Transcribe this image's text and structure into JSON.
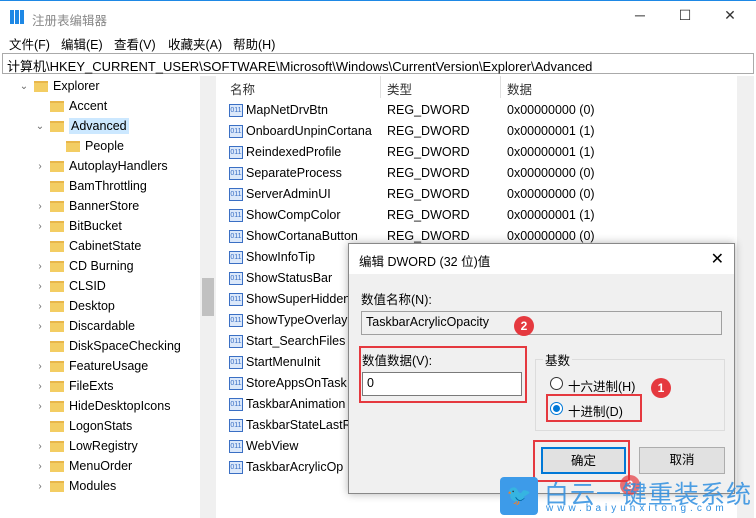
{
  "window": {
    "title": "注册表编辑器",
    "minimize": "─",
    "maximize": "☐",
    "close": "✕"
  },
  "menu": [
    "文件(F)",
    "编辑(E)",
    "查看(V)",
    "收藏夹(A)",
    "帮助(H)"
  ],
  "address": "计算机\\HKEY_CURRENT_USER\\SOFTWARE\\Microsoft\\Windows\\CurrentVersion\\Explorer\\Advanced",
  "tree": [
    {
      "label": "Explorer",
      "level": 0,
      "expanded": true
    },
    {
      "label": "Accent",
      "level": 1
    },
    {
      "label": "Advanced",
      "level": 1,
      "expanded": true,
      "selected": true
    },
    {
      "label": "People",
      "level": 2
    },
    {
      "label": "AutoplayHandlers",
      "level": 1,
      "collapsed": true
    },
    {
      "label": "BamThrottling",
      "level": 1
    },
    {
      "label": "BannerStore",
      "level": 1,
      "collapsed": true
    },
    {
      "label": "BitBucket",
      "level": 1,
      "collapsed": true
    },
    {
      "label": "CabinetState",
      "level": 1
    },
    {
      "label": "CD Burning",
      "level": 1,
      "collapsed": true
    },
    {
      "label": "CLSID",
      "level": 1,
      "collapsed": true
    },
    {
      "label": "Desktop",
      "level": 1,
      "collapsed": true
    },
    {
      "label": "Discardable",
      "level": 1,
      "collapsed": true
    },
    {
      "label": "DiskSpaceChecking",
      "level": 1
    },
    {
      "label": "FeatureUsage",
      "level": 1,
      "collapsed": true
    },
    {
      "label": "FileExts",
      "level": 1,
      "collapsed": true
    },
    {
      "label": "HideDesktopIcons",
      "level": 1,
      "collapsed": true
    },
    {
      "label": "LogonStats",
      "level": 1
    },
    {
      "label": "LowRegistry",
      "level": 1,
      "collapsed": true
    },
    {
      "label": "MenuOrder",
      "level": 1,
      "collapsed": true
    },
    {
      "label": "Modules",
      "level": 1,
      "collapsed": true
    }
  ],
  "list": {
    "headers": [
      "名称",
      "类型",
      "数据"
    ],
    "rows": [
      [
        "MapNetDrvBtn",
        "REG_DWORD",
        "0x00000000 (0)"
      ],
      [
        "OnboardUnpinCortana",
        "REG_DWORD",
        "0x00000001 (1)"
      ],
      [
        "ReindexedProfile",
        "REG_DWORD",
        "0x00000001 (1)"
      ],
      [
        "SeparateProcess",
        "REG_DWORD",
        "0x00000000 (0)"
      ],
      [
        "ServerAdminUI",
        "REG_DWORD",
        "0x00000000 (0)"
      ],
      [
        "ShowCompColor",
        "REG_DWORD",
        "0x00000001 (1)"
      ],
      [
        "ShowCortanaButton",
        "REG_DWORD",
        "0x00000000 (0)"
      ],
      [
        "ShowInfoTip",
        "",
        ""
      ],
      [
        "ShowStatusBar",
        "",
        ""
      ],
      [
        "ShowSuperHidden",
        "",
        ""
      ],
      [
        "ShowTypeOverlay",
        "",
        ""
      ],
      [
        "Start_SearchFiles",
        "",
        ""
      ],
      [
        "StartMenuInit",
        "",
        ""
      ],
      [
        "StoreAppsOnTask",
        "",
        ""
      ],
      [
        "TaskbarAnimation",
        "",
        ""
      ],
      [
        "TaskbarStateLastR",
        "",
        ""
      ],
      [
        "WebView",
        "",
        ""
      ],
      [
        "TaskbarAcrylicOp",
        "",
        ""
      ]
    ]
  },
  "dialog": {
    "title": "编辑 DWORD (32 位)值",
    "close": "✕",
    "name_label": "数值名称(N):",
    "name_value": "TaskbarAcrylicOpacity",
    "data_label": "数值数据(V):",
    "data_value": "0",
    "base_label": "基数",
    "hex_label": "十六进制(H)",
    "dec_label": "十进制(D)",
    "selected_base": "decimal",
    "ok": "确定",
    "cancel": "取消"
  },
  "badges": [
    "1",
    "2",
    "3"
  ],
  "watermark": {
    "text": "白云一键重装系统",
    "url": "www.baiyunxitong.com"
  },
  "colors": {
    "accent": "#0078d7",
    "highlight": "#e5393f"
  }
}
